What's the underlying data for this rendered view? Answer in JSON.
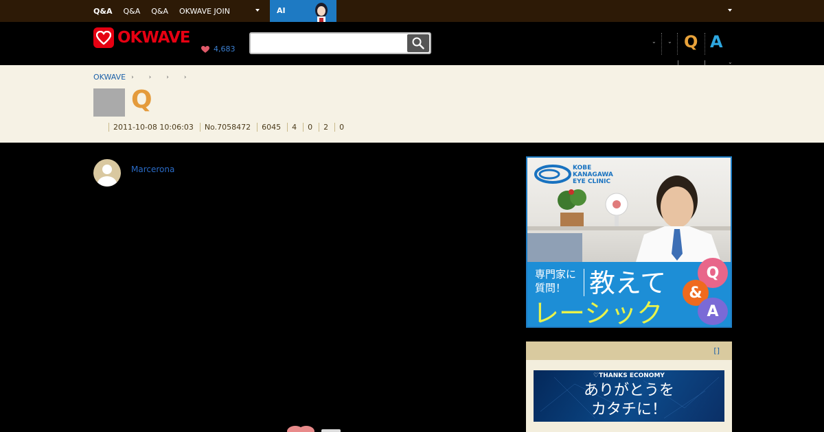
{
  "topbar": {
    "nav": [
      "Q&A",
      "Q&A",
      "Q&A",
      "OKWAVE JOIN"
    ],
    "ai_label": "AI"
  },
  "header": {
    "logo_text": "OKWAVE",
    "thanks_count": "4,683",
    "search": {
      "value": "",
      "placeholder": ""
    },
    "q_label": "Q",
    "a_label": "A"
  },
  "question": {
    "breadcrumb": [
      "OKWAVE"
    ],
    "q_mark": "Q",
    "meta": {
      "datetime": "2011-10-08 10:06:03",
      "number": "No.7058472",
      "views": "6045",
      "answers": "4",
      "stat3": "0",
      "stat4": "2",
      "stat5": "0"
    }
  },
  "main": {
    "username": "Marcerona"
  },
  "sidebar": {
    "ad1": {
      "clinic_lines": [
        "KOBE",
        "KANAGAWA",
        "EYE CLINIC"
      ],
      "text_left_1": "専門家に",
      "text_left_2": "質問！",
      "text_big": "教えて",
      "text_yellow": "レーシック",
      "bubble_q": "Q",
      "bubble_amp": "&",
      "bubble_a": "A"
    },
    "box2": {
      "header_link": "[]",
      "banner_small": "♡THANKS ECONOMY",
      "banner_line1": "ありがとうを",
      "banner_line2": "カタチに！"
    }
  },
  "colors": {
    "topbar_bg": "#2d1a06",
    "brand_red": "#e60012",
    "q_orange": "#e49b3c",
    "a_blue": "#2ea7e0",
    "band_bg": "#f6f2e5",
    "link_blue": "#1a5fa8"
  }
}
